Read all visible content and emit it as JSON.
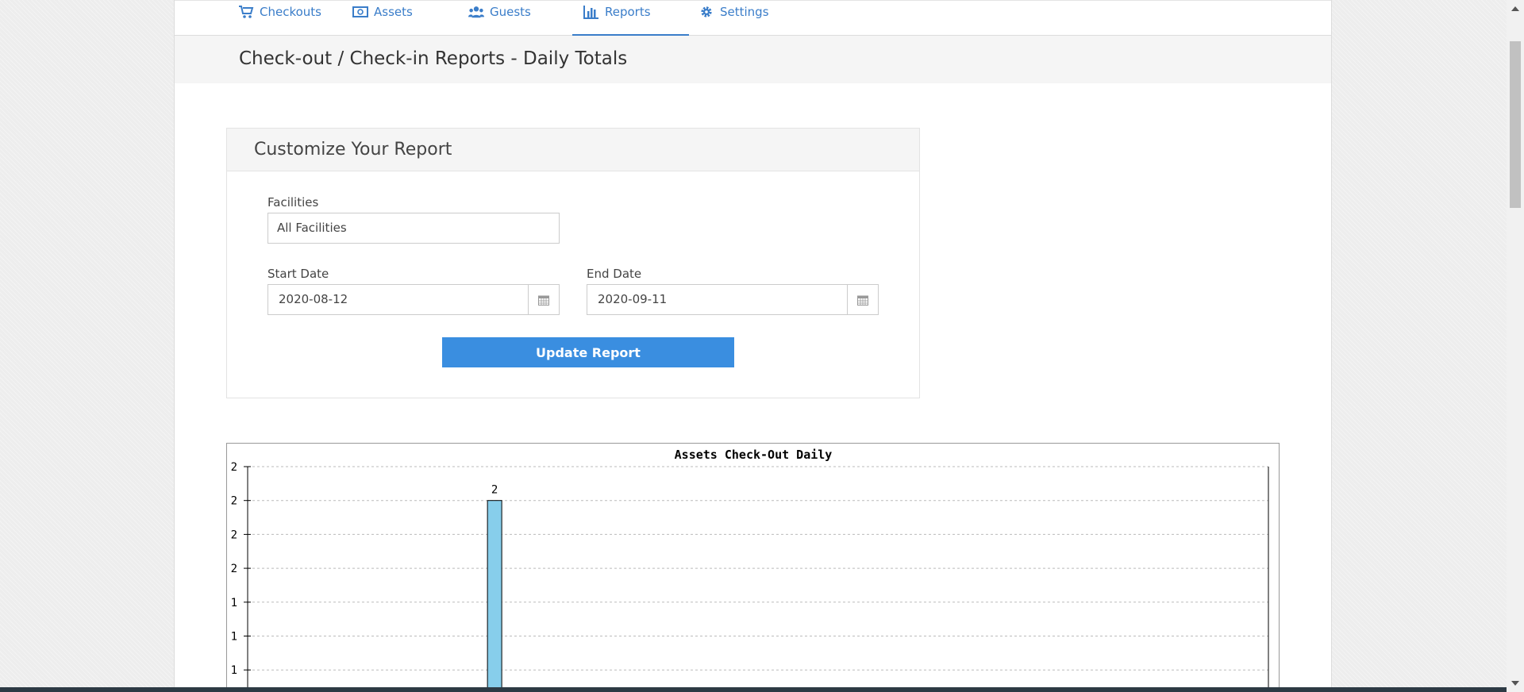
{
  "nav": {
    "items": [
      {
        "label": "Checkouts",
        "icon": "cart-icon"
      },
      {
        "label": "Assets",
        "icon": "money-icon"
      },
      {
        "label": "Guests",
        "icon": "users-icon"
      },
      {
        "label": "Reports",
        "icon": "bar-chart-icon",
        "active": true
      },
      {
        "label": "Settings",
        "icon": "gear-icon"
      }
    ]
  },
  "page": {
    "title": "Check-out / Check-in Reports - Daily Totals"
  },
  "form": {
    "heading": "Customize Your Report",
    "facilities_label": "Facilities",
    "facilities_value": "All Facilities",
    "start_label": "Start Date",
    "start_value": "2020-08-12",
    "end_label": "End Date",
    "end_value": "2020-09-11",
    "submit_label": "Update Report"
  },
  "colors": {
    "accent": "#3a7dc9",
    "button": "#3a8ee0",
    "bar": "#87ceeb"
  },
  "chart_data": {
    "type": "bar",
    "title": "Assets Check-Out Daily",
    "y_tick_labels": [
      "2",
      "2",
      "2",
      "2",
      "1",
      "1",
      "1"
    ],
    "bars": [
      {
        "index": 7,
        "value": 2,
        "label": "2"
      }
    ],
    "category_count": 31,
    "grid": true
  }
}
